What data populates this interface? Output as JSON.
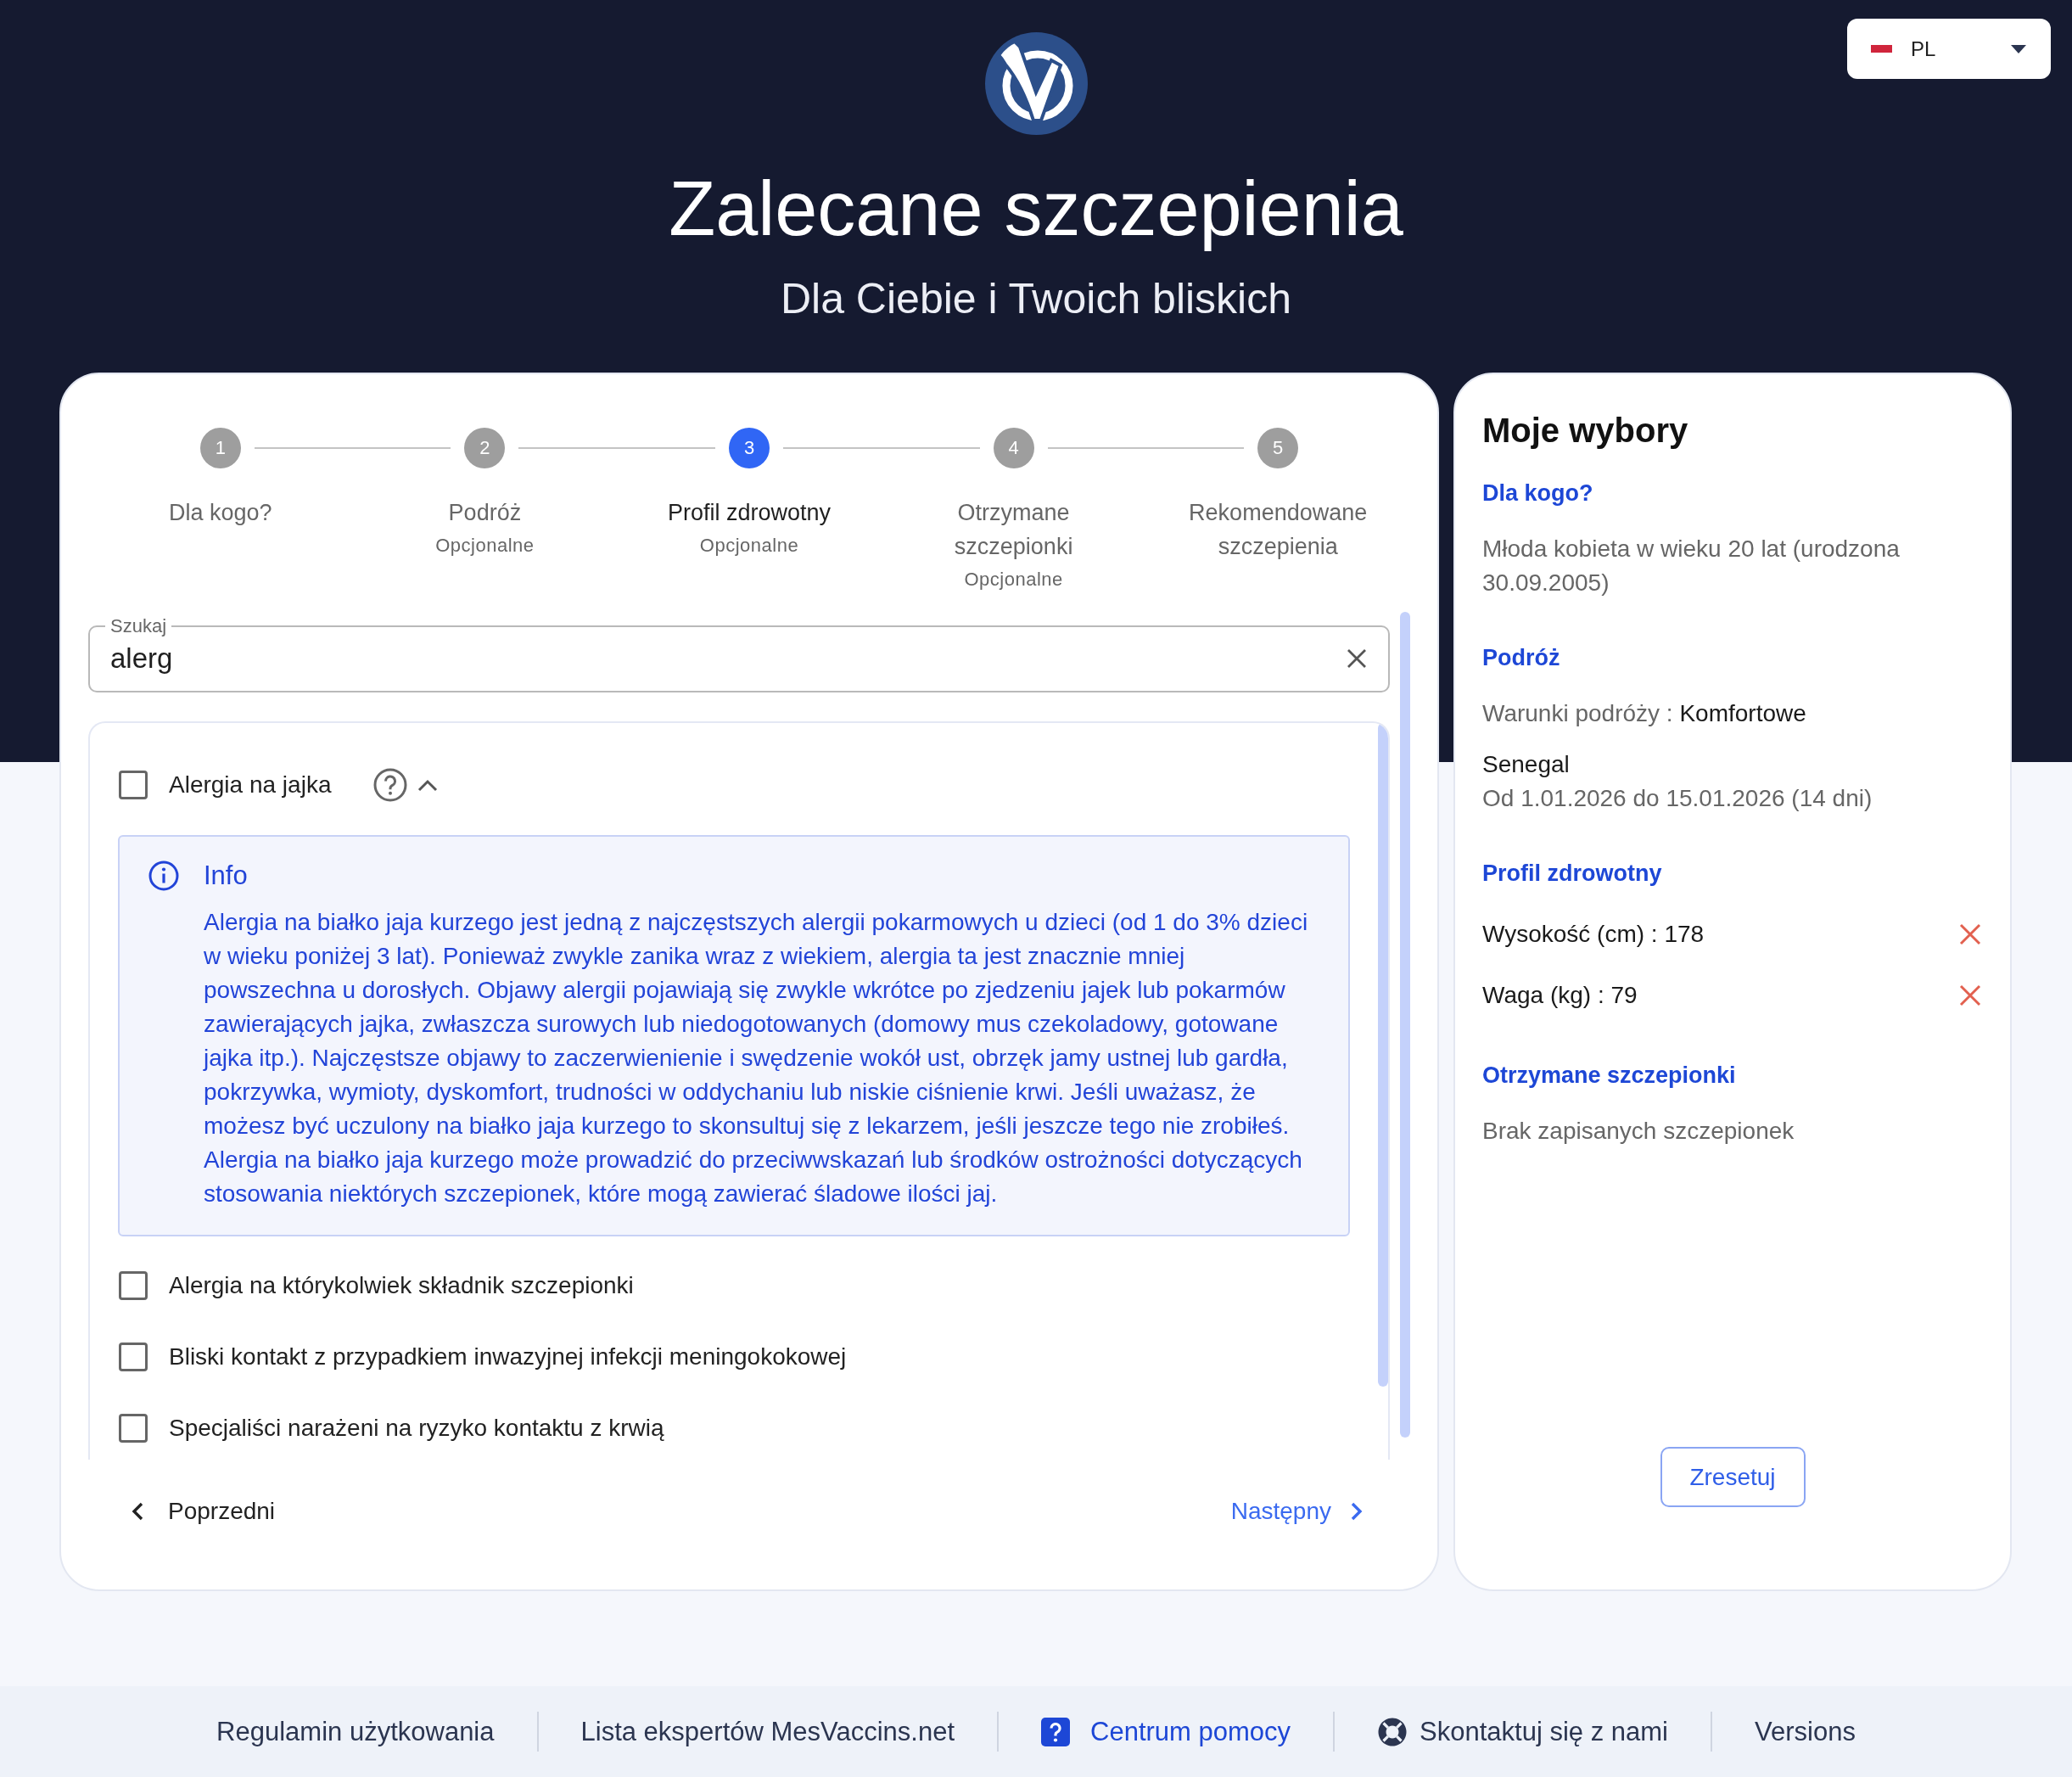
{
  "header": {
    "title": "Zalecane szczepienia",
    "subtitle": "Dla Ciebie i Twoich bliskich"
  },
  "language_selector": {
    "value": "PL"
  },
  "stepper": {
    "steps": [
      {
        "number": "1",
        "label": "Dla kogo?",
        "selected": false
      },
      {
        "number": "2",
        "label": "Podróż",
        "sublabel": "Opcjonalne",
        "selected": false
      },
      {
        "number": "3",
        "label": "Profil zdrowotny",
        "sublabel": "Opcjonalne",
        "selected": true
      },
      {
        "number": "4",
        "label": "Otrzymane szczepionki",
        "sublabel": "Opcjonalne",
        "selected": false
      },
      {
        "number": "5",
        "label": "Rekomendowane szczepienia",
        "selected": false
      }
    ]
  },
  "search": {
    "label": "Szukaj",
    "value": "alerg"
  },
  "conditions": [
    {
      "label": "Alergia na jajka",
      "checked": false,
      "expanded": true,
      "info": {
        "title": "Info",
        "text": "Alergia na białko jaja kurzego jest jedną z najczęstszych alergii pokarmowych u dzieci (od 1 do 3% dzieci w wieku poniżej 3 lat). Ponieważ zwykle zanika wraz z wiekiem, alergia ta jest znacznie mniej powszechna u dorosłych. Objawy alergii pojawiają się zwykle wkrótce po zjedzeniu jajek lub pokarmów zawierających jajka, zwłaszcza surowych lub niedogotowanych (domowy mus czekoladowy, gotowane jajka itp.). Najczęstsze objawy to zaczerwienienie i swędzenie wokół ust, obrzęk jamy ustnej lub gardła, pokrzywka, wymioty, dyskomfort, trudności w oddychaniu lub niskie ciśnienie krwi. Jeśli uważasz, że możesz być uczulony na białko jaja kurzego to skonsultuj się z lekarzem, jeśli jeszcze tego nie zrobiłeś. Alergia na białko jaja kurzego może prowadzić do przeciwwskazań lub środków ostrożności dotyczących stosowania niektórych szczepionek, które mogą zawierać śladowe ilości jaj."
      }
    },
    {
      "label": "Alergia na którykolwiek składnik szczepionki",
      "checked": false
    },
    {
      "label": "Bliski kontakt z przypadkiem inwazyjnej infekcji meningokokowej",
      "checked": false
    },
    {
      "label": "Specjaliści narażeni na ryzyko kontaktu z krwią",
      "checked": false
    }
  ],
  "navigation": {
    "previous": "Poprzedni",
    "next": "Następny"
  },
  "summary": {
    "title": "Moje wybory",
    "sections": [
      {
        "heading": "Dla kogo?",
        "entries": [
          {
            "kind": "note",
            "text": "Młoda kobieta w wieku 20 lat (urodzona 30.09.2005)"
          }
        ]
      },
      {
        "heading": "Podróż",
        "entries": [
          {
            "kind": "pair",
            "label": "Warunki podróży :",
            "value": "Komfortowe"
          },
          {
            "kind": "destination",
            "name": "Senegal",
            "dates": "Od 1.01.2026 do 15.01.2026 (14 dni)"
          }
        ]
      },
      {
        "heading": "Profil zdrowotny",
        "entries": [
          {
            "kind": "removable",
            "text": "Wysokość (cm) : 178"
          },
          {
            "kind": "removable",
            "text": "Waga (kg) : 79"
          }
        ]
      },
      {
        "heading": "Otrzymane szczepionki",
        "entries": [
          {
            "kind": "note",
            "text": "Brak zapisanych szczepionek"
          }
        ]
      }
    ],
    "reset_button": "Zresetuj"
  },
  "footer": [
    {
      "kind": "link",
      "label": "Regulamin użytkowania"
    },
    {
      "kind": "link",
      "label": "Lista ekspertów MesVaccins.net"
    },
    {
      "kind": "help",
      "label": "Centrum pomocy"
    },
    {
      "kind": "contact",
      "label": "Skontaktuj się z nami"
    },
    {
      "kind": "link",
      "label": "Versions"
    }
  ]
}
